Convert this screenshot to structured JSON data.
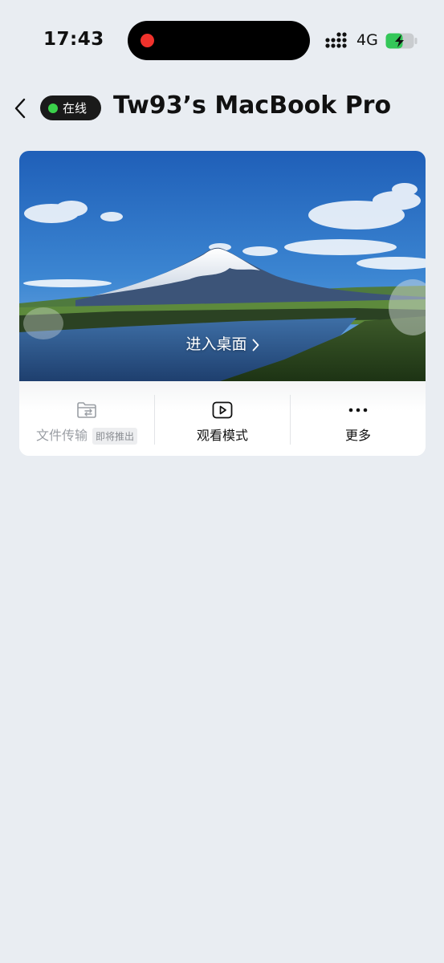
{
  "status_bar": {
    "time": "17:43",
    "network": "4G",
    "battery_level": 0.6,
    "battery_color": "#34c759"
  },
  "header": {
    "status_badge": "在线",
    "status_color": "#3bd14b",
    "title": "Tw93’s MacBook Pro"
  },
  "card": {
    "enter_label": "进入桌面",
    "actions": {
      "file_transfer": {
        "label": "文件传输",
        "tag": "即将推出",
        "icon": "folder-transfer-icon",
        "enabled": false
      },
      "watch_mode": {
        "label": "观看模式",
        "icon": "play-icon"
      },
      "more": {
        "label": "更多",
        "icon": "more-dots-icon"
      }
    }
  }
}
